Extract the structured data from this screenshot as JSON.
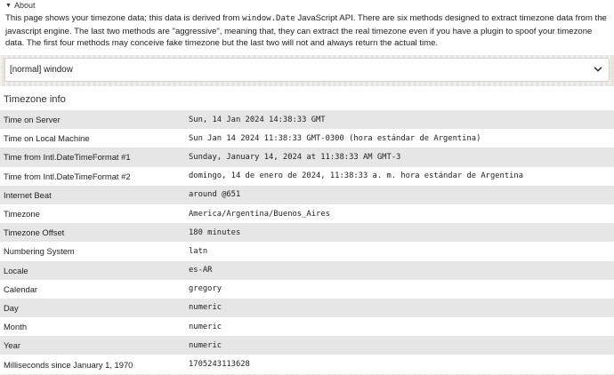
{
  "about": {
    "summary": "About",
    "text_before_code": "This page shows your timezone data; this data is derived from ",
    "code": "window.Date",
    "text_after_code": " JavaScript API. There are six methods designed to extract timezone data from the javascript engine. The last two methods are \"aggressive\", meaning that, they can extract the real timezone even if you have a plugin to spoof your timezone data. The first four methods may conceive fake timezone but the last two will not and always return the actual time."
  },
  "mode_select": {
    "selected": "[normal] window"
  },
  "timezone_info": {
    "heading": "Timezone info",
    "rows": [
      {
        "label": "Time on Server",
        "value": "Sun, 14 Jan 2024 14:38:33 GMT"
      },
      {
        "label": "Time on Local Machine",
        "value": "Sun Jan 14 2024 11:38:33 GMT-0300 (hora estándar de Argentina)"
      },
      {
        "label": "Time from Intl.DateTimeFormat #1",
        "value": "Sunday, January 14, 2024 at 11:38:33 AM GMT-3"
      },
      {
        "label": "Time from Intl.DateTimeFormat #2",
        "value": "domingo, 14 de enero de 2024, 11:38:33 a. m. hora estándar de Argentina"
      },
      {
        "label": "Internet Beat",
        "value": "around @651"
      },
      {
        "label": "Timezone",
        "value": "America/Argentina/Buenos_Aires"
      },
      {
        "label": "Timezone Offset",
        "value": "180 minutes"
      },
      {
        "label": "Numbering System",
        "value": "latn"
      },
      {
        "label": "Locale",
        "value": "es-AR"
      },
      {
        "label": "Calendar",
        "value": "gregory"
      },
      {
        "label": "Day",
        "value": "numeric"
      },
      {
        "label": "Month",
        "value": "numeric"
      },
      {
        "label": "Year",
        "value": "numeric"
      },
      {
        "label": "Milliseconds since January 1, 1970",
        "value": "1705243113628"
      }
    ]
  },
  "icons": {
    "disclosure": "triangle-down-icon",
    "select_arrow": "chevron-down-icon"
  }
}
